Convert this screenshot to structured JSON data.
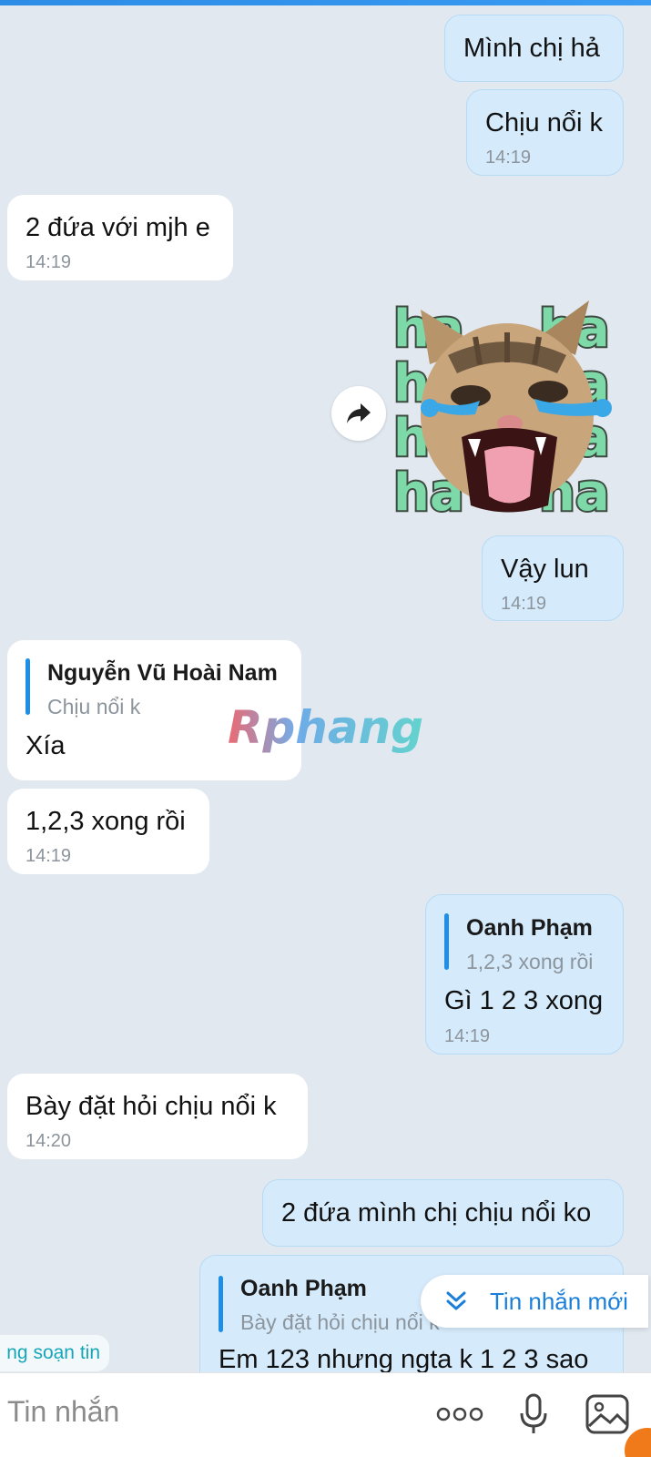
{
  "messages": [
    {
      "id": "m1",
      "side": "me",
      "text": "Mình chị hả",
      "time": ""
    },
    {
      "id": "m2",
      "side": "me",
      "text": "Chịu nổi k",
      "time": "14:19"
    },
    {
      "id": "m3",
      "side": "them",
      "text": "2 đứa với mjh e",
      "time": "14:19"
    },
    {
      "id": "m4",
      "side": "me",
      "sticker": "laughing-cat-ha-ha-sticker",
      "sticker_text": "ha"
    },
    {
      "id": "m5",
      "side": "me",
      "text": "Vậy lun",
      "time": "14:19"
    },
    {
      "id": "m6",
      "side": "them",
      "quote_name": "Nguyễn Vũ Hoài Nam",
      "quote_text": "Chịu nổi k",
      "text": "Xía",
      "time": ""
    },
    {
      "id": "m7",
      "side": "them",
      "text": "1,2,3 xong rồi",
      "time": "14:19"
    },
    {
      "id": "m8",
      "side": "me",
      "quote_name": "Oanh Phạm",
      "quote_text": "1,2,3 xong rồi",
      "text": "Gì 1 2 3 xong",
      "time": "14:19"
    },
    {
      "id": "m9",
      "side": "them",
      "text": "Bày đặt hỏi chịu nổi k",
      "time": "14:20"
    },
    {
      "id": "m10",
      "side": "me",
      "text": "2 đứa mình chị chịu nổi ko",
      "time": ""
    },
    {
      "id": "m11",
      "side": "me",
      "quote_name": "Oanh Phạm",
      "quote_text": "Bày đặt hỏi chịu nổi k",
      "text": "Em 123 nhưng ngta k 1 2 3 sao",
      "time": ""
    }
  ],
  "watermark": {
    "text": "Rphang"
  },
  "new_messages_button": {
    "label": "Tin nhắn mới",
    "icon": "double-chevron-down-icon"
  },
  "typing_indicator": {
    "text": "ng soạn tin"
  },
  "composer": {
    "placeholder": "Tin nhắn",
    "icons": [
      "more-icon",
      "microphone-icon",
      "image-icon"
    ]
  },
  "colors": {
    "background": "#e1e8f0",
    "outgoing_bubble": "#d5ebfc",
    "incoming_bubble": "#ffffff",
    "accent": "#1e8fe6",
    "time": "#8c949c"
  }
}
